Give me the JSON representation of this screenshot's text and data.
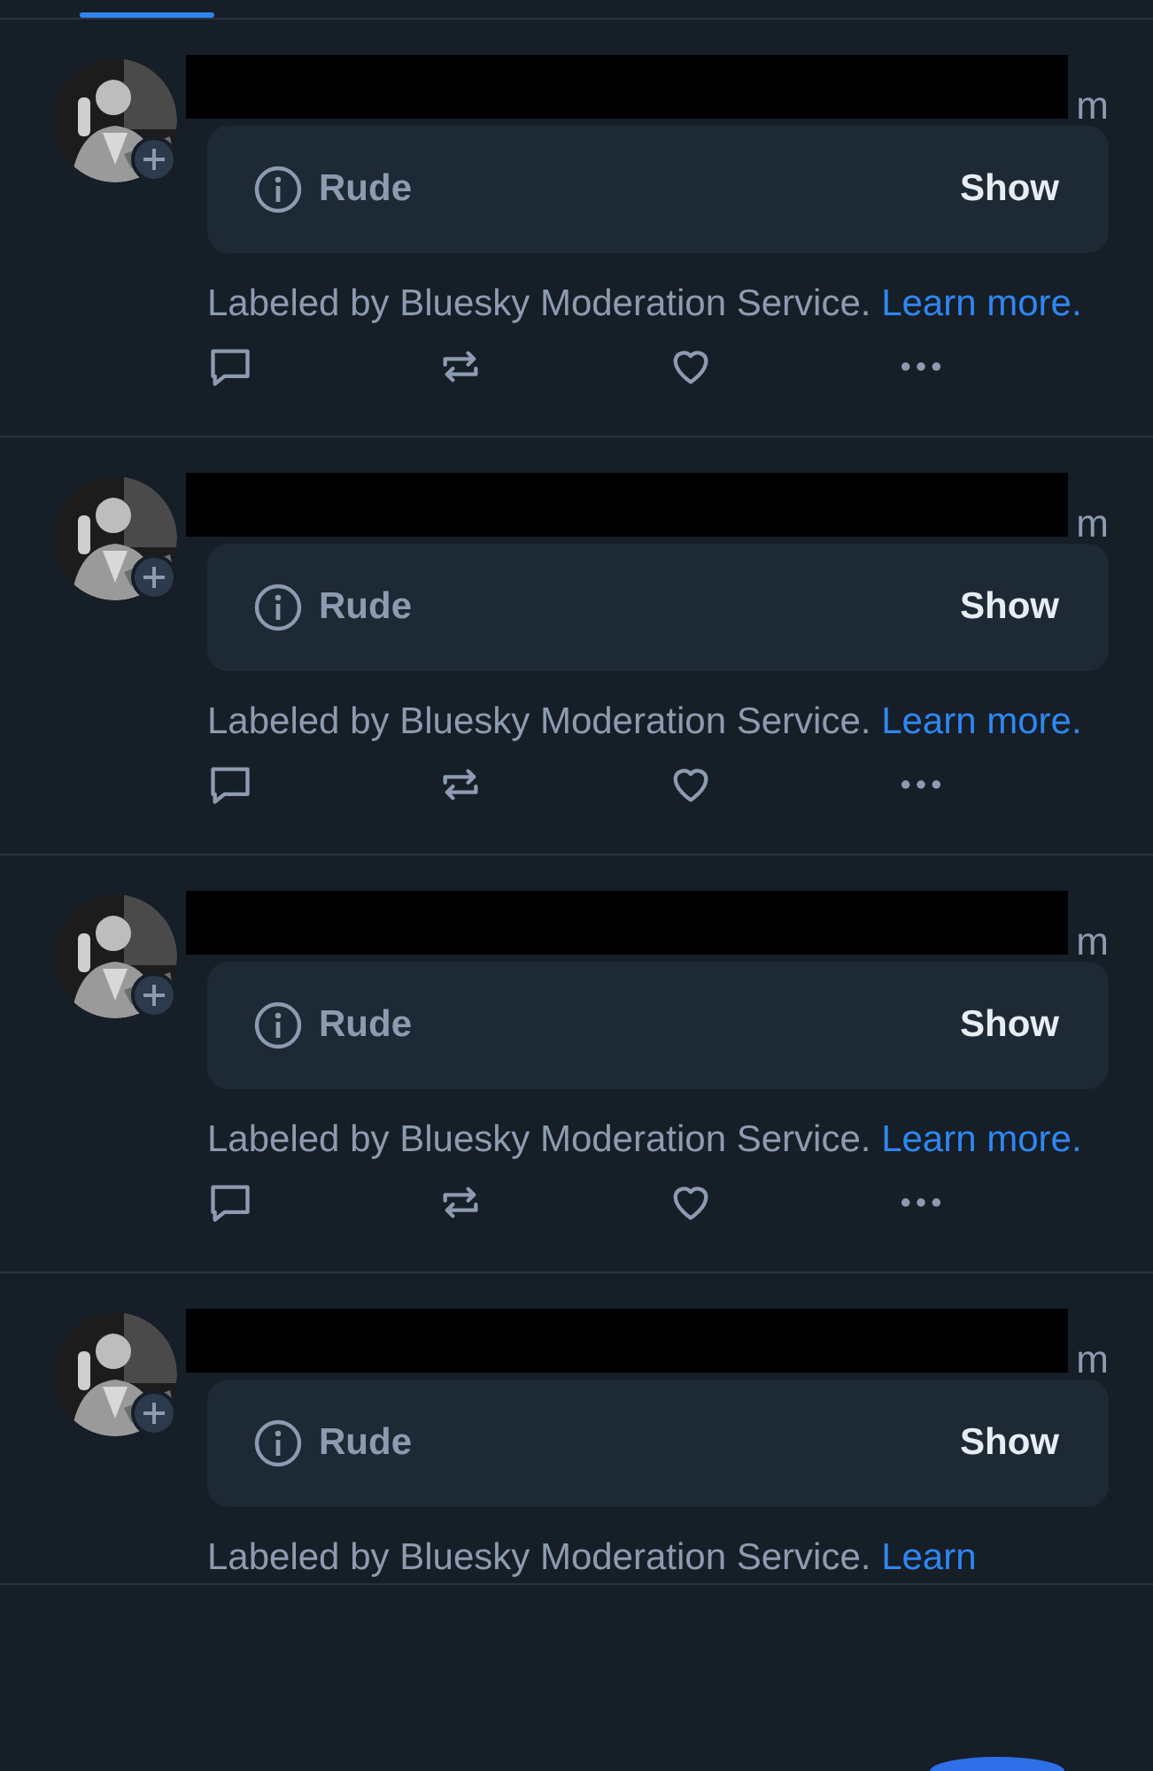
{
  "tab_bar": {
    "selected_indicator": true
  },
  "posts": [
    {
      "redacted": true,
      "name_tail": "m",
      "label": {
        "name": "Rude",
        "action": "Show"
      },
      "notice": "Labeled by Bluesky Moderation Service.",
      "link": "Learn more.",
      "actions": [
        {
          "kind": "reply"
        },
        {
          "kind": "repost"
        },
        {
          "kind": "like"
        },
        {
          "kind": "more"
        }
      ]
    },
    {
      "redacted": true,
      "name_tail": "m",
      "label": {
        "name": "Rude",
        "action": "Show"
      },
      "notice": "Labeled by Bluesky Moderation Service.",
      "link": "Learn more.",
      "actions": [
        {
          "kind": "reply"
        },
        {
          "kind": "repost"
        },
        {
          "kind": "like"
        },
        {
          "kind": "more"
        }
      ]
    },
    {
      "redacted": true,
      "name_tail": "m",
      "label": {
        "name": "Rude",
        "action": "Show"
      },
      "notice": "Labeled by Bluesky Moderation Service.",
      "link": "Learn more.",
      "actions": [
        {
          "kind": "reply"
        },
        {
          "kind": "repost"
        },
        {
          "kind": "like"
        },
        {
          "kind": "more"
        }
      ]
    },
    {
      "redacted": true,
      "name_tail": "m",
      "label": {
        "name": "Rude",
        "action": "Show"
      },
      "notice": "Labeled by Bluesky Moderation Service.",
      "link": "Learn"
    }
  ],
  "floating_button": true
}
